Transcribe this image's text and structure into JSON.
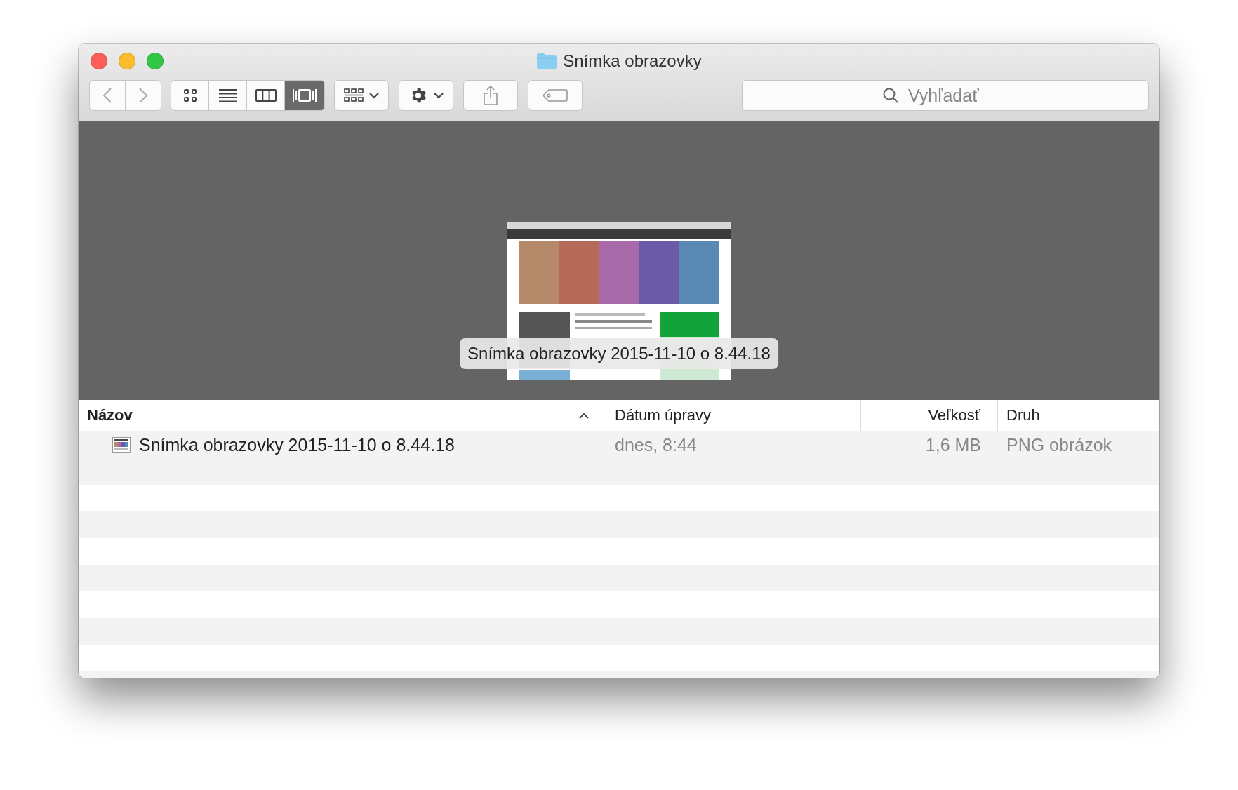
{
  "window": {
    "title": "Snímka obrazovky"
  },
  "toolbar": {
    "view_modes": [
      {
        "kind": "icons",
        "selected": false
      },
      {
        "kind": "list",
        "selected": false
      },
      {
        "kind": "columns",
        "selected": false
      },
      {
        "kind": "coverflow",
        "selected": true
      }
    ],
    "search": {
      "placeholder": "Vyhľadať"
    }
  },
  "preview": {
    "caption": "Snímka obrazovky 2015-11-10 o 8.44.18"
  },
  "table": {
    "columns": [
      {
        "label": "Názov",
        "sorted": true
      },
      {
        "label": "Dátum úpravy",
        "sorted": false
      },
      {
        "label": "Veľkosť",
        "sorted": false
      },
      {
        "label": "Druh",
        "sorted": false
      }
    ],
    "rows": [
      {
        "name": "Snímka obrazovky 2015-11-10 o 8.44.18",
        "modified": "dnes, 8:44",
        "size": "1,6 MB",
        "kind": "PNG obrázok",
        "selected": false
      }
    ]
  }
}
